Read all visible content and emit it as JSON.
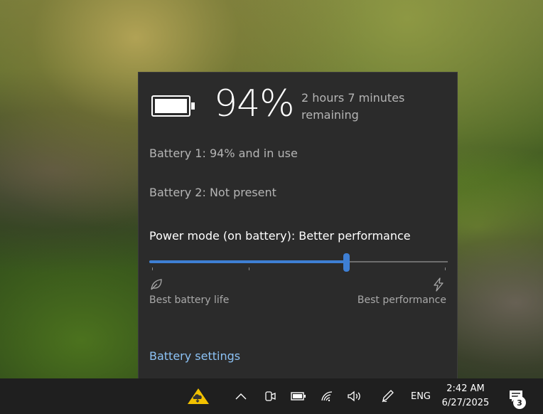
{
  "battery_flyout": {
    "percent": "94%",
    "remaining": "2 hours 7 minutes remaining",
    "battery1": "Battery 1: 94% and in use",
    "battery2": "Battery 2: Not present",
    "power_mode": "Power mode (on battery): Better performance",
    "slider_level": 0.66,
    "left_label": "Best battery life",
    "right_label": "Best performance",
    "settings_link": "Battery settings",
    "accent": "#3e7fd4",
    "link_color": "#8cc2f5"
  },
  "taskbar": {
    "icons": [
      "weather-cloud-icon",
      "chevron-up-icon",
      "camera-icon",
      "battery-icon",
      "wifi-icon",
      "volume-icon",
      "pen-icon",
      "notification-icon"
    ],
    "language": "ENG",
    "time": "2:42 AM",
    "date": "6/27/2025",
    "notification_count": "3"
  }
}
